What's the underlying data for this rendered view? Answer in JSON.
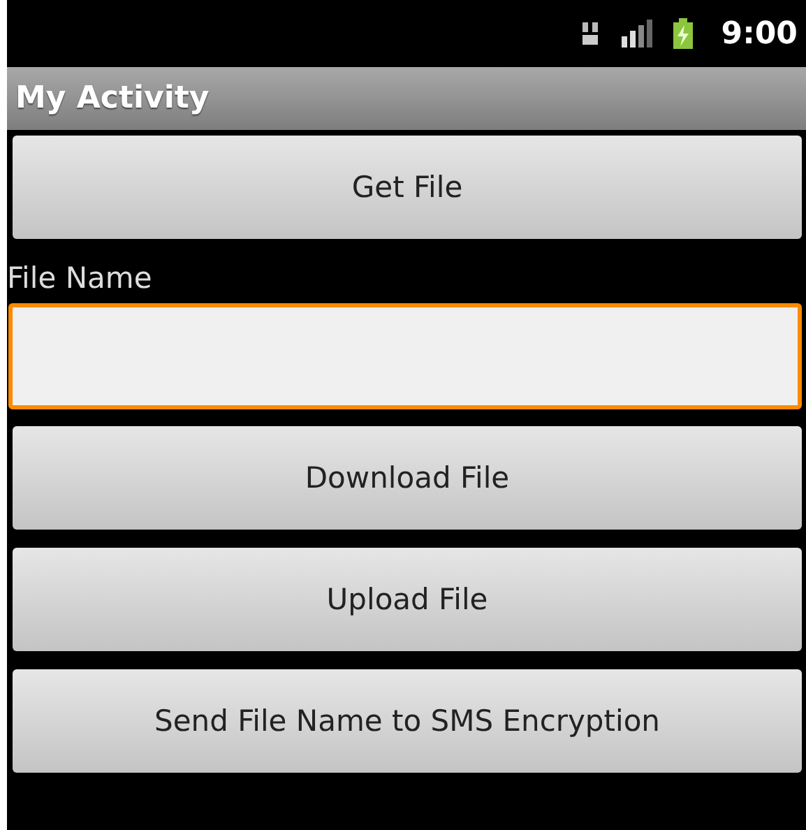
{
  "status_bar": {
    "time": "9:00"
  },
  "title_bar": {
    "title": "My Activity"
  },
  "buttons_top": [
    "Get File"
  ],
  "field": {
    "label": "File Name",
    "focused": true
  },
  "buttons": [
    "Download File",
    "Upload File",
    "Send File Name to SMS Encryption"
  ]
}
